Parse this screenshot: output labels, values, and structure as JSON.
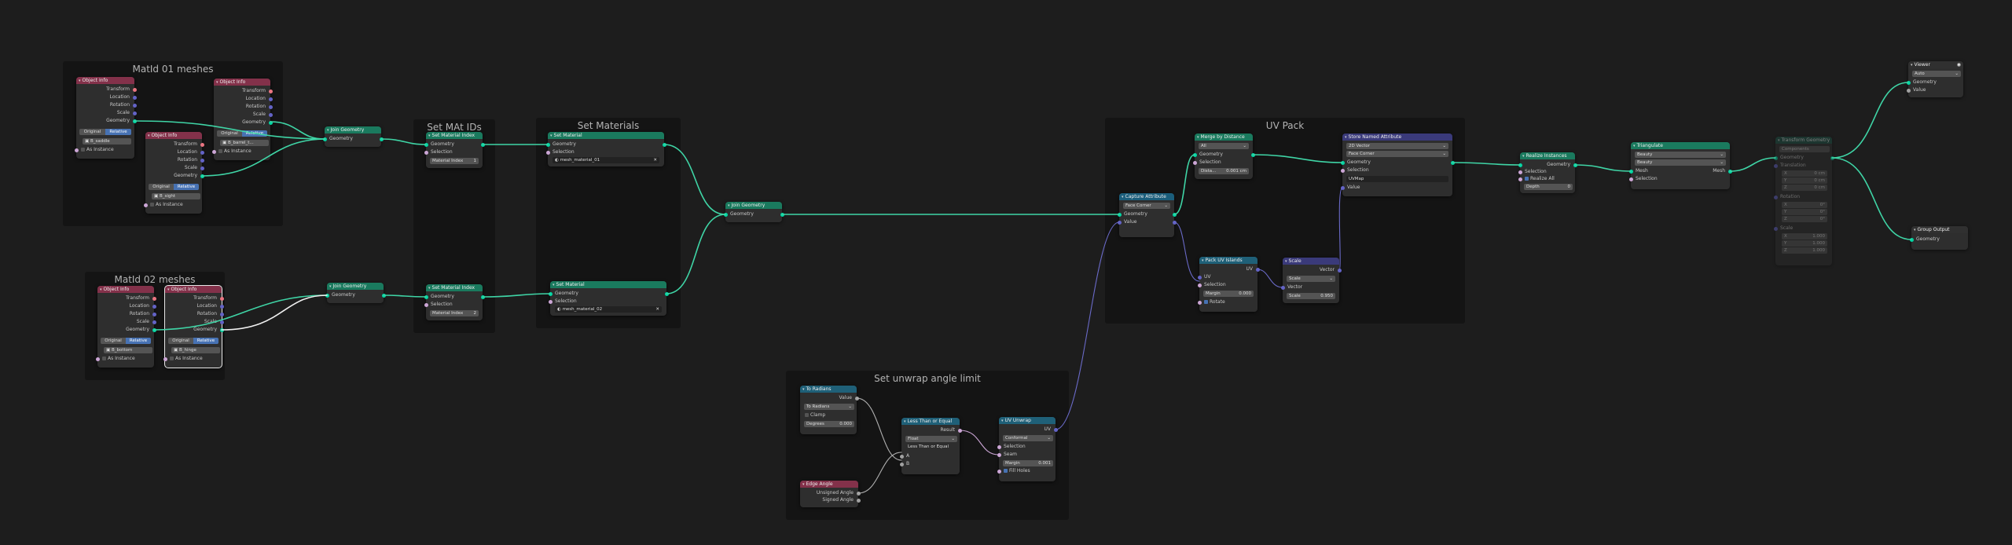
{
  "frames": {
    "matid01": "MatId 01 meshes",
    "matid02": "MatId 02 meshes",
    "set_mat_ids": "Set MAt IDs",
    "set_materials": "Set Materials",
    "uv_pack": "UV Pack",
    "unwrap": "Set unwrap angle limit"
  },
  "object_info": {
    "title": "Object Info",
    "transform": "Transform",
    "location": "Location",
    "rotation": "Rotation",
    "scale": "Scale",
    "geometry": "Geometry",
    "original": "Original",
    "relative": "Relative",
    "as_instance": "As Instance",
    "obj1": "B_saddle",
    "obj2": "B_barrel_t...",
    "obj3": "B_sight",
    "obj4": "B_bottom",
    "obj5": "B_hinge"
  },
  "join": {
    "title": "Join Geometry",
    "geometry": "Geometry"
  },
  "set_material_index": {
    "title": "Set Material Index",
    "geometry": "Geometry",
    "selection": "Selection",
    "field": "Material Index",
    "val1": "1",
    "val2": "2"
  },
  "set_material": {
    "title": "Set Material",
    "geometry": "Geometry",
    "selection": "Selection",
    "mat1": "mesh_material_01",
    "mat2": "mesh_material_02"
  },
  "capture": {
    "title": "Capture Attribute",
    "domain": "Face Corner",
    "geometry": "Geometry",
    "value": "Value"
  },
  "merge": {
    "title": "Merge by Distance",
    "mode": "All",
    "geometry": "Geometry",
    "selection": "Selection",
    "distance_label": "Dista...",
    "distance": "0.001 cm"
  },
  "store": {
    "title": "Store Named Attribute",
    "type": "2D Vector",
    "domain": "Face Corner",
    "geometry": "Geometry",
    "selection": "Selection",
    "name": "UVMap",
    "value": "Value"
  },
  "pack": {
    "title": "Pack UV Islands",
    "uv_out": "UV",
    "uv": "UV",
    "selection": "Selection",
    "margin_label": "Margin",
    "margin": "0.000",
    "rotate": "Rotate"
  },
  "scale_node": {
    "title": "Scale",
    "vector_out": "Vector",
    "op": "Scale",
    "vector": "Vector",
    "scale_label": "Scale",
    "scale": "0.950"
  },
  "realize": {
    "title": "Realize Instances",
    "geometry_out": "Geometry",
    "geometry": "Geometry",
    "selection": "Selection",
    "realize_all": "Realize All",
    "depth_label": "Depth",
    "depth": "0"
  },
  "triangulate": {
    "title": "Triangulate",
    "quad": "Beauty",
    "ngon": "Beauty",
    "mesh_out": "Mesh",
    "mesh": "Mesh",
    "selection": "Selection"
  },
  "transform_geo": {
    "title": "Transform Geometry",
    "mode": "Components",
    "geometry": "Geometry",
    "translation": "Translation",
    "rotation": "Rotation",
    "scale": "Scale",
    "x": "X",
    "y": "Y",
    "z": "Z",
    "tval": "0 cm",
    "rval": "0°",
    "sval": "1.000"
  },
  "viewer": {
    "title": "Viewer",
    "mode": "Auto",
    "geometry": "Geometry",
    "value": "Value"
  },
  "group_output": {
    "title": "Group Output",
    "geometry": "Geometry"
  },
  "to_radians": {
    "title": "To Radians",
    "value_out": "Value",
    "op": "To Radians",
    "clamp": "Clamp",
    "degrees_label": "Degrees",
    "degrees": "0.000"
  },
  "compare": {
    "title": "Less Than or Equal",
    "result": "Result",
    "type": "Float",
    "op": "Less Than or Equal",
    "a": "A",
    "b": "B"
  },
  "edge_angle": {
    "title": "Edge Angle",
    "unsigned": "Unsigned Angle",
    "signed": "Signed Angle"
  },
  "uv_unwrap": {
    "title": "UV Unwrap",
    "uv_out": "UV",
    "method": "Conformal",
    "selection": "Selection",
    "seam": "Seam",
    "margin_label": "Margin",
    "margin": "0.001",
    "fill_holes": "Fill Holes"
  }
}
